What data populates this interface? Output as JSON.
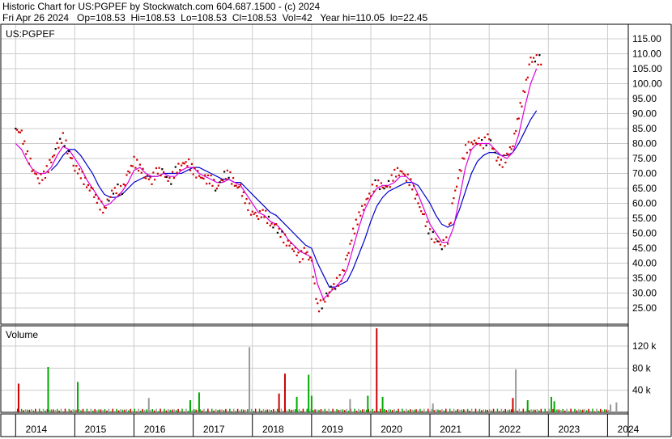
{
  "header": {
    "line1": "Historic Chart for US:PGPEF by Stockwatch.com 604.687.1500 - (c) 2024",
    "line2": "Fri Apr 26 2024   Op=108.53  Hi=108.53  Lo=108.53  Cl=108.53  Vol=42   Year hi=110.05  lo=22.45"
  },
  "colors": {
    "price_dots": "#cc0000",
    "price_dots_alt": "#000000",
    "ma_short": "#dd00dd",
    "ma_long": "#0000cc",
    "volume_up": "#00aa00",
    "volume_down": "#cc0000",
    "volume_neutral": "#999999",
    "grid": "#cccccc"
  },
  "chart_data": [
    {
      "type": "line",
      "title": "US:PGPEF",
      "price_axis_ticks": [
        "115.00",
        "110.00",
        "105.00",
        "100.00",
        "95.00",
        "90.00",
        "85.00",
        "80.00",
        "75.00",
        "70.00",
        "65.00",
        "60.00",
        "55.00",
        "50.00",
        "45.00",
        "40.00",
        "35.00",
        "30.00",
        "25.00"
      ],
      "ylim": [
        20,
        118
      ],
      "x_tick_labels": [
        "2014",
        "2015",
        "2016",
        "2017",
        "2018",
        "2019",
        "2020",
        "2021",
        "2022",
        "2023",
        "2024"
      ],
      "x": [
        2014.0,
        2014.1,
        2014.2,
        2014.3,
        2014.4,
        2014.5,
        2014.6,
        2014.7,
        2014.8,
        2014.9,
        2015.0,
        2015.1,
        2015.2,
        2015.3,
        2015.4,
        2015.5,
        2015.6,
        2015.7,
        2015.8,
        2015.9,
        2016.0,
        2016.1,
        2016.2,
        2016.3,
        2016.4,
        2016.5,
        2016.6,
        2016.7,
        2016.8,
        2016.9,
        2017.0,
        2017.1,
        2017.2,
        2017.3,
        2017.4,
        2017.5,
        2017.6,
        2017.7,
        2017.8,
        2017.9,
        2018.0,
        2018.1,
        2018.2,
        2018.3,
        2018.4,
        2018.5,
        2018.6,
        2018.7,
        2018.8,
        2018.9,
        2019.0,
        2019.1,
        2019.2,
        2019.3,
        2019.4,
        2019.5,
        2019.6,
        2019.7,
        2019.8,
        2019.9,
        2020.0,
        2020.1,
        2020.2,
        2020.3,
        2020.4,
        2020.5,
        2020.6,
        2020.7,
        2020.8,
        2020.9,
        2021.0,
        2021.1,
        2021.2,
        2021.3,
        2021.4,
        2021.5,
        2021.6,
        2021.7,
        2021.8,
        2021.9,
        2022.0,
        2022.1,
        2022.2,
        2022.3,
        2022.4,
        2022.5,
        2022.6,
        2022.7,
        2022.8,
        2022.9,
        2023.0,
        2023.1,
        2023.2,
        2023.3,
        2023.4,
        2023.5,
        2023.6,
        2023.7,
        2023.8,
        2023.9,
        2024.0,
        2024.1,
        2024.2,
        2024.3
      ],
      "series": [
        {
          "role": "price",
          "values": [
            85,
            83,
            76,
            71,
            68,
            70,
            74,
            79,
            82,
            77,
            72,
            70,
            66,
            64,
            60,
            58,
            63,
            65,
            64,
            70,
            74,
            72,
            69,
            68,
            71,
            70,
            67,
            71,
            73,
            74,
            71,
            69,
            68,
            68,
            65,
            69,
            70,
            66,
            65,
            60,
            57,
            56,
            57,
            53,
            52,
            49,
            47,
            45,
            42,
            44,
            40,
            25,
            27,
            31,
            33,
            35,
            42,
            50,
            56,
            60,
            64,
            67,
            65,
            66,
            70,
            71,
            69,
            66,
            60,
            55,
            50,
            48,
            46,
            48,
            62,
            70,
            78,
            80,
            81,
            80,
            82,
            76,
            73,
            76,
            80,
            90,
            98,
            108,
            108
          ]
        },
        {
          "role": "ma_short",
          "values": [
            80,
            78,
            74,
            71,
            70,
            70,
            72,
            76,
            79,
            78,
            75,
            72,
            68,
            65,
            62,
            59,
            60,
            62,
            64,
            67,
            71,
            72,
            70,
            69,
            69,
            70,
            69,
            69,
            71,
            72,
            72,
            70,
            69,
            68,
            67,
            67,
            68,
            67,
            66,
            63,
            60,
            57,
            56,
            54,
            53,
            51,
            48,
            46,
            44,
            43,
            42,
            33,
            28,
            30,
            32,
            34,
            38,
            45,
            52,
            58,
            62,
            65,
            66,
            66,
            67,
            69,
            69,
            67,
            63,
            58,
            53,
            50,
            47,
            47,
            52,
            62,
            72,
            78,
            80,
            80,
            80,
            78,
            76,
            75,
            77,
            83,
            92,
            100,
            105
          ]
        },
        {
          "role": "ma_long",
          "values": [
            null,
            null,
            null,
            null,
            null,
            null,
            71,
            73,
            76,
            78,
            78,
            76,
            73,
            70,
            66,
            63,
            62,
            62,
            63,
            65,
            67,
            68,
            69,
            69,
            69,
            70,
            70,
            70,
            70,
            71,
            72,
            72,
            71,
            70,
            69,
            68,
            68,
            67,
            67,
            65,
            63,
            61,
            59,
            57,
            56,
            54,
            52,
            50,
            48,
            46,
            45,
            40,
            36,
            32,
            32,
            33,
            34,
            38,
            43,
            48,
            54,
            59,
            62,
            64,
            65,
            66,
            67,
            67,
            66,
            63,
            60,
            56,
            53,
            52,
            53,
            58,
            64,
            70,
            74,
            76,
            77,
            77,
            76,
            76,
            77,
            80,
            84,
            88,
            91
          ]
        }
      ]
    },
    {
      "type": "bar",
      "title": "Volume",
      "volume_axis_ticks": [
        "120 k",
        "80 k",
        "40 k"
      ],
      "ylim": [
        0,
        140000
      ],
      "highlights": [
        {
          "x": 2014.05,
          "value": 52000,
          "color": "down"
        },
        {
          "x": 2014.55,
          "value": 82000,
          "color": "up"
        },
        {
          "x": 2015.05,
          "value": 55000,
          "color": "up"
        },
        {
          "x": 2016.25,
          "value": 26000,
          "color": "neutral"
        },
        {
          "x": 2016.95,
          "value": 22000,
          "color": "up"
        },
        {
          "x": 2017.1,
          "value": 36000,
          "color": "up"
        },
        {
          "x": 2017.95,
          "value": 118000,
          "color": "neutral"
        },
        {
          "x": 2018.45,
          "value": 34000,
          "color": "down"
        },
        {
          "x": 2018.55,
          "value": 70000,
          "color": "down"
        },
        {
          "x": 2018.75,
          "value": 28000,
          "color": "up"
        },
        {
          "x": 2018.95,
          "value": 68000,
          "color": "up"
        },
        {
          "x": 2019.0,
          "value": 30000,
          "color": "up"
        },
        {
          "x": 2019.65,
          "value": 24000,
          "color": "neutral"
        },
        {
          "x": 2019.95,
          "value": 30000,
          "color": "up"
        },
        {
          "x": 2020.1,
          "value": 152000,
          "color": "down"
        },
        {
          "x": 2020.2,
          "value": 28000,
          "color": "up"
        },
        {
          "x": 2021.05,
          "value": 16000,
          "color": "neutral"
        },
        {
          "x": 2022.45,
          "value": 78000,
          "color": "neutral"
        },
        {
          "x": 2022.4,
          "value": 26000,
          "color": "down"
        },
        {
          "x": 2022.65,
          "value": 22000,
          "color": "up"
        },
        {
          "x": 2023.05,
          "value": 28000,
          "color": "up"
        },
        {
          "x": 2023.1,
          "value": 20000,
          "color": "up"
        },
        {
          "x": 2024.05,
          "value": 14000,
          "color": "neutral"
        },
        {
          "x": 2024.15,
          "value": 18000,
          "color": "neutral"
        }
      ]
    }
  ]
}
